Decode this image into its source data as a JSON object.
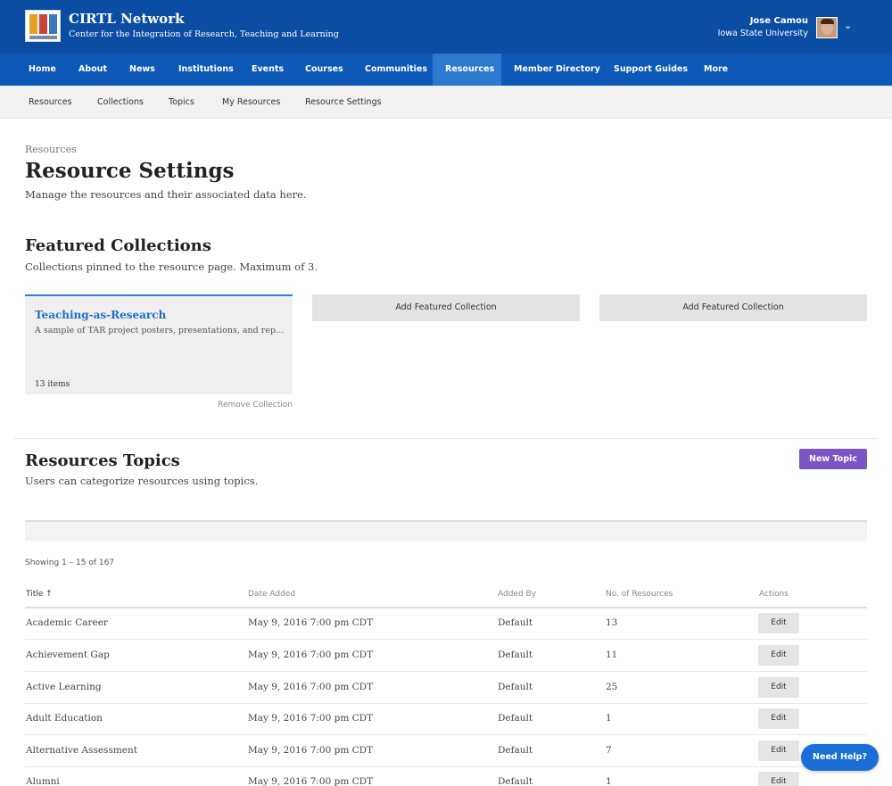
{
  "header": {
    "brand_title": "CIRTL Network",
    "brand_subtitle": "Center for the Integration of Research, Teaching and Learning",
    "user_name": "Jose Camou",
    "user_org": "Iowa State University"
  },
  "main_nav": [
    "Home",
    "About",
    "News",
    "Institutions",
    "Events",
    "Courses",
    "Communities",
    "Resources",
    "Member Directory",
    "Support Guides",
    "More"
  ],
  "main_nav_active": "Resources",
  "sub_nav": [
    "Resources",
    "Collections",
    "Topics",
    "My Resources",
    "Resource Settings"
  ],
  "page": {
    "breadcrumb": "Resources",
    "title": "Resource Settings",
    "description": "Manage the resources and their associated data here."
  },
  "featured": {
    "heading": "Featured Collections",
    "description": "Collections pinned to the resource page. Maximum of 3.",
    "card": {
      "title": "Teaching-as-Research",
      "description": "A sample of TAR project posters, presentations, and reports from CIRTL institutions",
      "count": "13 items"
    },
    "remove_label": "Remove Collection",
    "add_label": "Add Featured Collection"
  },
  "topics": {
    "heading": "Resources Topics",
    "description": "Users can categorize resources using topics.",
    "new_button": "New Topic",
    "showing": "Showing 1 – 15 of 167",
    "columns": {
      "title": "Title ↑",
      "date": "Date Added",
      "added_by": "Added By",
      "count": "No. of Resources",
      "actions": "Actions"
    },
    "rows": [
      {
        "title": "Academic Career",
        "date": "May 9, 2016 7:00 pm CDT",
        "added_by": "Default",
        "count": "13",
        "action": "Edit"
      },
      {
        "title": "Achievement Gap",
        "date": "May 9, 2016 7:00 pm CDT",
        "added_by": "Default",
        "count": "11",
        "action": "Edit"
      },
      {
        "title": "Active Learning",
        "date": "May 9, 2016 7:00 pm CDT",
        "added_by": "Default",
        "count": "25",
        "action": "Edit"
      },
      {
        "title": "Adult Education",
        "date": "May 9, 2016 7:00 pm CDT",
        "added_by": "Default",
        "count": "1",
        "action": "Edit"
      },
      {
        "title": "Alternative Assessment",
        "date": "May 9, 2016 7:00 pm CDT",
        "added_by": "Default",
        "count": "7",
        "action": "Edit"
      },
      {
        "title": "Alumni",
        "date": "May 9, 2016 7:00 pm CDT",
        "added_by": "Default",
        "count": "1",
        "action": "Edit"
      }
    ]
  },
  "help_button": "Need Help?",
  "colors": {
    "header_bg": "#0a4da3",
    "nav_bg": "#0e59b8",
    "nav_active": "#2d79cf",
    "link": "#1f6fc8",
    "new_topic": "#7b55c5",
    "help": "#1a6fd6"
  },
  "icons": {
    "avatar": "user-avatar",
    "menu": "chevron-down-icon",
    "sort": "arrow-up-icon"
  }
}
